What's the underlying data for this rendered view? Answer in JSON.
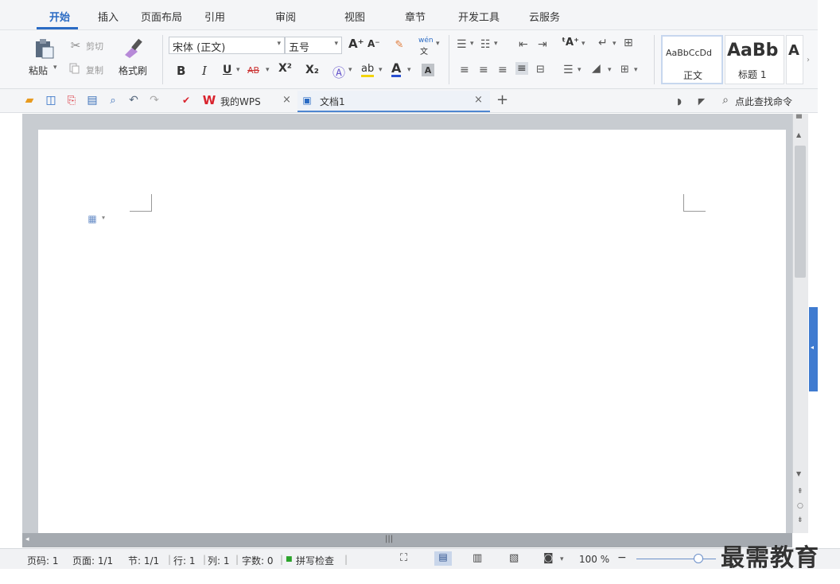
{
  "menu": {
    "tabs": [
      {
        "label": "开始",
        "active": true
      },
      {
        "label": "插入"
      },
      {
        "label": "页面布局"
      },
      {
        "label": "引用"
      },
      {
        "label": "审阅"
      },
      {
        "label": "视图"
      },
      {
        "label": "章节"
      },
      {
        "label": "开发工具"
      },
      {
        "label": "云服务"
      }
    ]
  },
  "ribbon": {
    "clipboard": {
      "paste": "粘贴",
      "cut": "剪切",
      "copy": "复制",
      "format_painter": "格式刷"
    },
    "font": {
      "name": "宋体 (正文)",
      "size": "五号",
      "bold": "B",
      "italic": "I",
      "underline": "U",
      "strike": "AB",
      "superscript": "X²",
      "subscript": "X₂",
      "grow": "A⁺",
      "shrink": "A⁻",
      "phonetic": "wén",
      "font_color": "A",
      "highlight": "ab"
    },
    "styles": {
      "normal_preview": "AaBbCcDd",
      "normal_label": "正文",
      "h1_preview": "AaBb",
      "h1_label": "标题 1",
      "h2_preview": "A"
    }
  },
  "toolbar": {
    "wps_tab": "我的WPS",
    "doc_tab": "文档1",
    "search": "点此查找命令"
  },
  "status": {
    "page_code": "页码: 1",
    "page": "页面: 1/1",
    "section": "节: 1/1",
    "line": "行: 1",
    "column": "列: 1",
    "word_count": "字数: 0",
    "spell_check": "拼写检查",
    "zoom": "100 %"
  },
  "watermark": "最需教育",
  "colors": {
    "accent": "#2a6bc4",
    "wps_red": "#d9232d"
  }
}
